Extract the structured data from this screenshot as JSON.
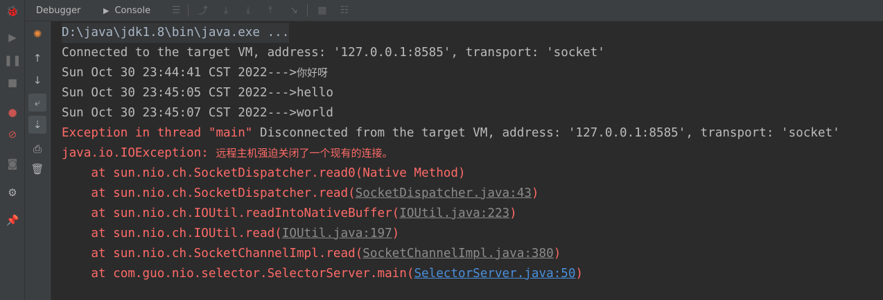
{
  "tabs": {
    "debugger_label": "Debugger",
    "console_label": "Console"
  },
  "colors": {
    "error_text": "#ff6b68",
    "normal_text": "#bbbbbb",
    "file_link": "#8c8c8c",
    "user_link": "#4a8fdd",
    "background": "#2b2b2b"
  },
  "console": {
    "command": "D:\\java\\jdk1.8\\bin\\java.exe ...",
    "connected": "Connected to the target VM, address: '127.0.0.1:8585', transport: 'socket'",
    "msg1_prefix": "Sun Oct 30 23:44:41 CST 2022--->",
    "msg1_text": "你好呀",
    "msg2": "Sun Oct 30 23:45:05 CST 2022--->hello",
    "msg3": "Sun Oct 30 23:45:07 CST 2022--->world",
    "exception_prefix": "Exception in thread \"main\" ",
    "disconnected": "Disconnected from the target VM, address: '127.0.0.1:8585', transport: 'socket'",
    "ioexception_prefix": "java.io.IOException: ",
    "ioexception_msg": "远程主机强迫关闭了一个现有的连接。",
    "stack": [
      {
        "at": "    at sun.nio.ch.SocketDispatcher.read0(Native Method)"
      },
      {
        "at": "    at sun.nio.ch.SocketDispatcher.read(",
        "link": "SocketDispatcher.java:43",
        "close": ")"
      },
      {
        "at": "    at sun.nio.ch.IOUtil.readIntoNativeBuffer(",
        "link": "IOUtil.java:223",
        "close": ")"
      },
      {
        "at": "    at sun.nio.ch.IOUtil.read(",
        "link": "IOUtil.java:197",
        "close": ")"
      },
      {
        "at": "    at sun.nio.ch.SocketChannelImpl.read(",
        "link": "SocketChannelImpl.java:380",
        "close": ")"
      },
      {
        "at": "    at com.guo.nio.selector.SelectorServer.main(",
        "link": "SelectorServer.java:50",
        "close": ")"
      }
    ]
  }
}
